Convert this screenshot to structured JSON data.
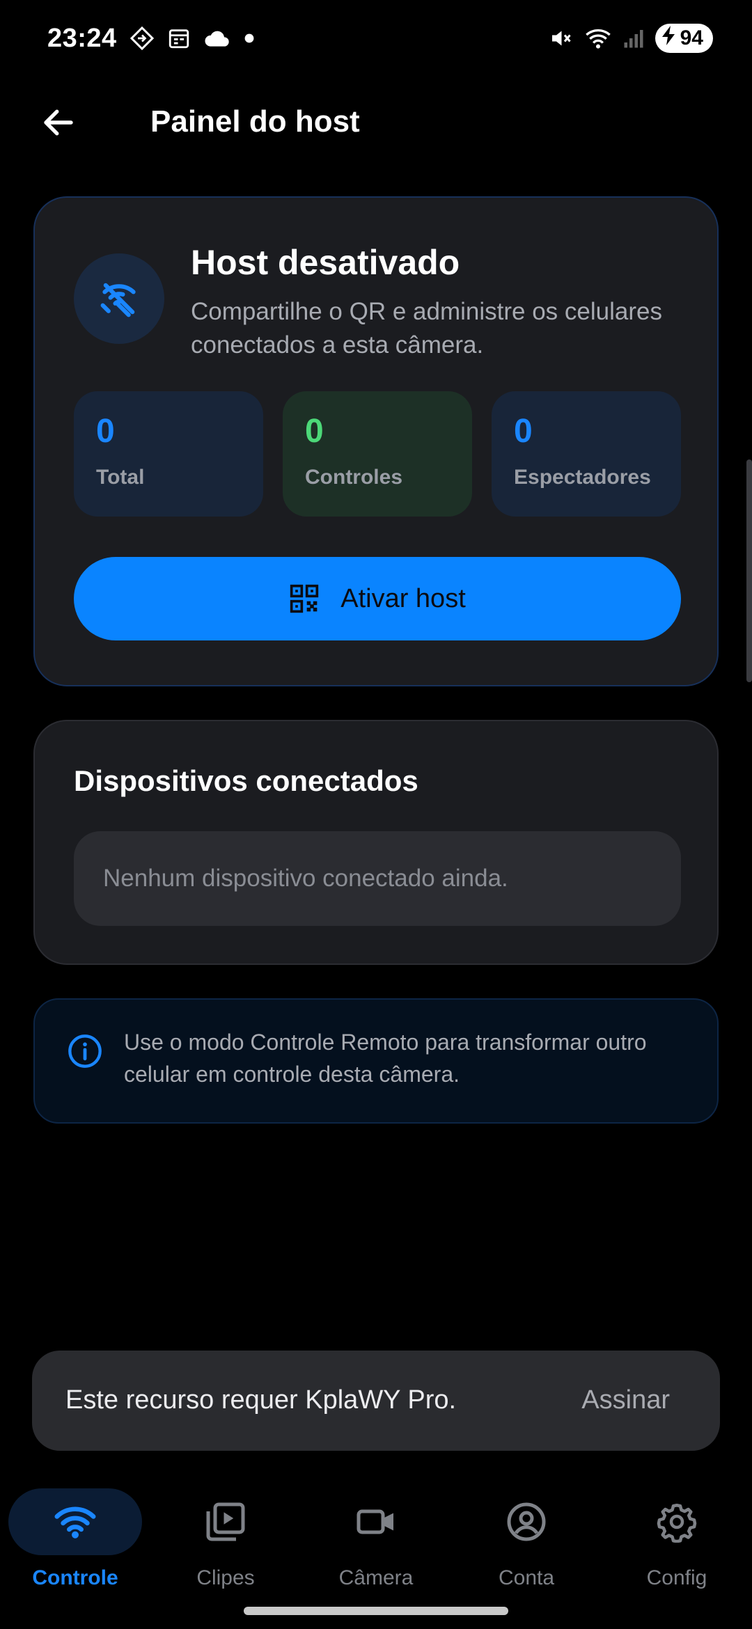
{
  "status_bar": {
    "time": "23:24",
    "battery": "94"
  },
  "app_bar": {
    "title": "Painel do host"
  },
  "host_card": {
    "title": "Host desativado",
    "description": "Compartilhe o QR e administre os celulares conectados a esta câmera.",
    "stats": [
      {
        "value": "0",
        "label": "Total"
      },
      {
        "value": "0",
        "label": "Controles"
      },
      {
        "value": "0",
        "label": "Espectadores"
      }
    ],
    "button_label": "Ativar host"
  },
  "devices_card": {
    "title": "Dispositivos conectados",
    "empty_message": "Nenhum dispositivo conectado ainda."
  },
  "info_card": {
    "text": "Use o modo Controle Remoto para transformar outro celular em controle desta câmera."
  },
  "snackbar": {
    "message": "Este recurso requer KplaWY Pro.",
    "action": "Assinar"
  },
  "bottom_nav": {
    "items": [
      {
        "label": "Controle",
        "icon": "wifi-icon",
        "active": true
      },
      {
        "label": "Clipes",
        "icon": "video-library-icon"
      },
      {
        "label": "Câmera",
        "icon": "videocam-icon"
      },
      {
        "label": "Conta",
        "icon": "account-circle-icon"
      },
      {
        "label": "Config",
        "icon": "gear-icon"
      }
    ]
  },
  "colors": {
    "accent": "#0a84ff",
    "success": "#4cd878",
    "background": "#000000",
    "card": "#1b1c20"
  }
}
